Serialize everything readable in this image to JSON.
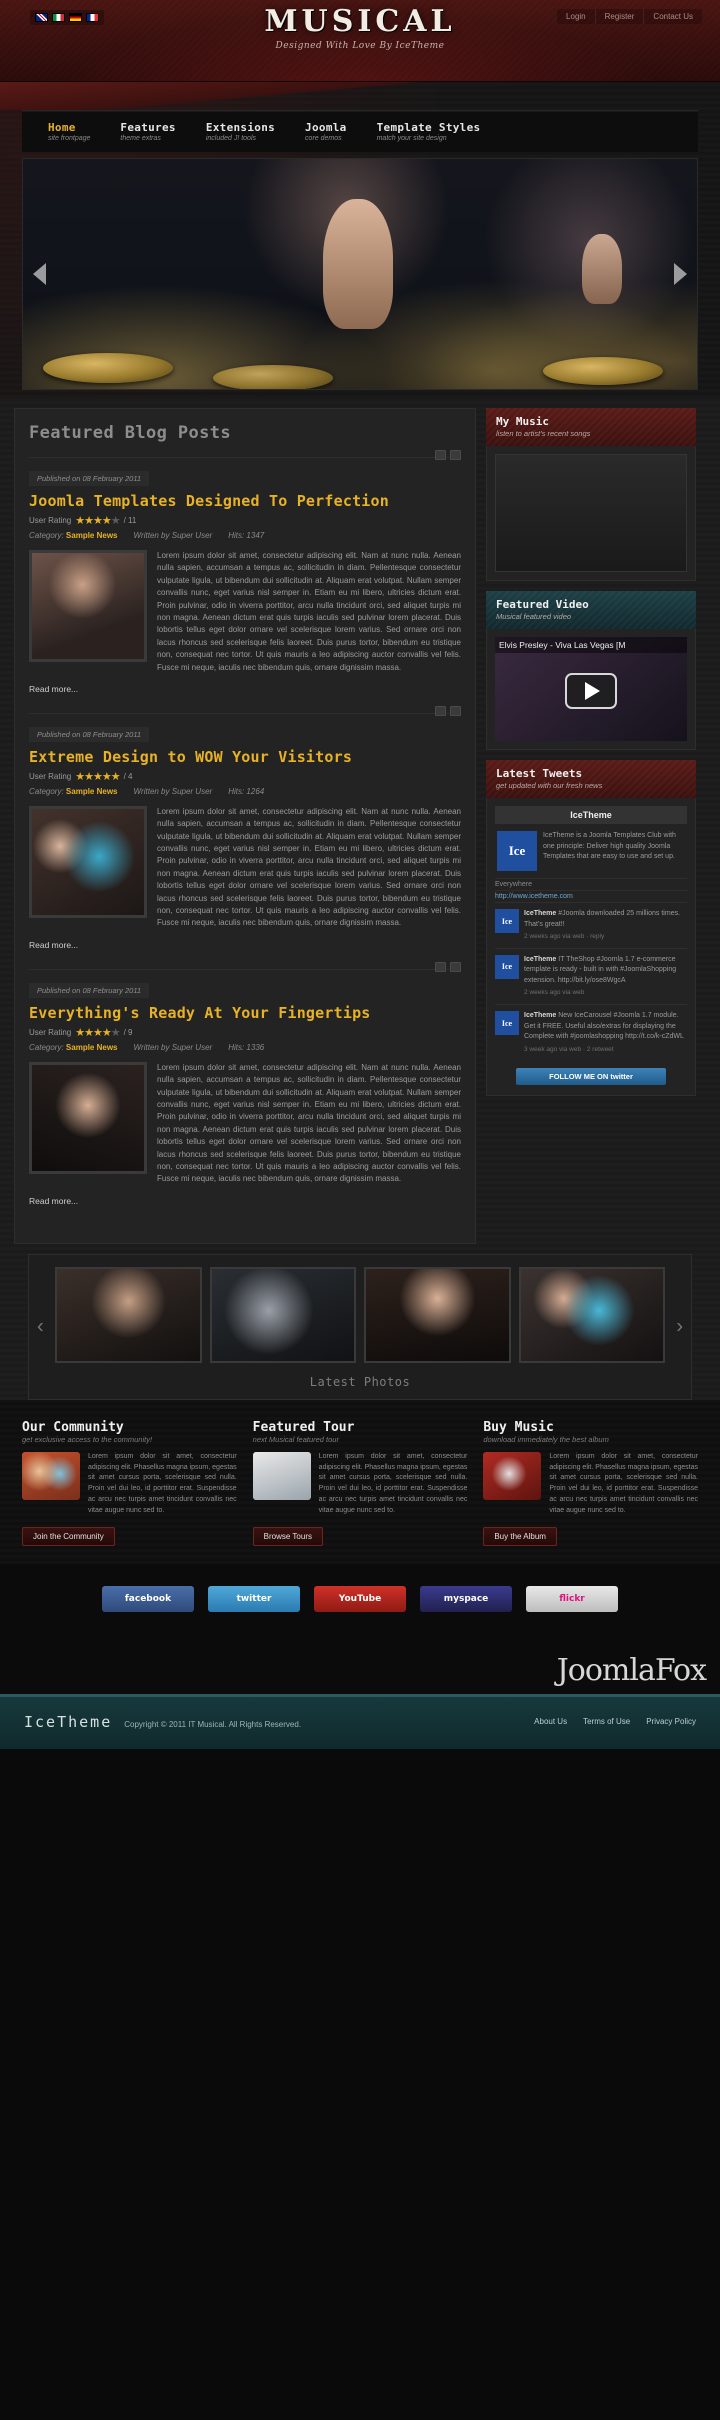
{
  "header": {
    "logo_title": "MUSICAL",
    "logo_sub": "Designed With Love By IceTheme",
    "flags": [
      "uk-flag",
      "italy-flag",
      "germany-flag",
      "france-flag"
    ],
    "top_links": [
      "Login",
      "Register",
      "Contact Us"
    ]
  },
  "nav": [
    {
      "title": "Home",
      "sub": "site frontpage",
      "active": true
    },
    {
      "title": "Features",
      "sub": "theme extras",
      "active": false
    },
    {
      "title": "Extensions",
      "sub": "included J! tools",
      "active": false
    },
    {
      "title": "Joomla",
      "sub": "core demos",
      "active": false
    },
    {
      "title": "Template Styles",
      "sub": "match your site design",
      "active": false
    }
  ],
  "main": {
    "section_title": "Featured Blog Posts",
    "read_more": "Read more...",
    "posts": [
      {
        "published": "Published on 08 February 2011",
        "title": "Joomla Templates Designed To Perfection",
        "rating_label": "User Rating",
        "stars_on": 4,
        "stars_off": 1,
        "votes": "/ 11",
        "category_label": "Category:",
        "category": "Sample News",
        "author": "Written by Super User",
        "hits": "Hits: 1347",
        "text": "Lorem ipsum dolor sit amet, consectetur adipiscing elit. Nam at nunc nulla. Aenean nulla sapien, accumsan a tempus ac, sollicitudin in diam. Pellentesque consectetur vulputate ligula, ut bibendum dui sollicitudin at. Aliquam erat volutpat. Nullam semper convallis nunc, eget varius nisl semper in. Etiam eu mi libero, ultricies dictum erat. Proin pulvinar, odio in viverra porttitor, arcu nulla tincidunt orci, sed aliquet turpis mi non magna. Aenean dictum erat quis turpis iaculis sed pulvinar lorem placerat. Duis lobortis tellus eget dolor ornare vel scelerisque lorem varius. Sed ornare orci non lacus rhoncus sed scelerisque felis laoreet. Duis purus tortor, bibendum eu tristique non, consequat nec tortor. Ut quis mauris a leo adipiscing auctor convallis vel felis. Fusce mi neque, iaculis nec bibendum quis, ornare dignissim massa."
      },
      {
        "published": "Published on 08 February 2011",
        "title": "Extreme Design to WOW Your Visitors",
        "rating_label": "User Rating",
        "stars_on": 5,
        "stars_off": 0,
        "votes": "/ 4",
        "category_label": "Category:",
        "category": "Sample News",
        "author": "Written by Super User",
        "hits": "Hits: 1264",
        "text": "Lorem ipsum dolor sit amet, consectetur adipiscing elit. Nam at nunc nulla. Aenean nulla sapien, accumsan a tempus ac, sollicitudin in diam. Pellentesque consectetur vulputate ligula, ut bibendum dui sollicitudin at. Aliquam erat volutpat. Nullam semper convallis nunc, eget varius nisl semper in. Etiam eu mi libero, ultricies dictum erat. Proin pulvinar, odio in viverra porttitor, arcu nulla tincidunt orci, sed aliquet turpis mi non magna. Aenean dictum erat quis turpis iaculis sed pulvinar lorem placerat. Duis lobortis tellus eget dolor ornare vel scelerisque lorem varius. Sed ornare orci non lacus rhoncus sed scelerisque felis laoreet. Duis purus tortor, bibendum eu tristique non, consequat nec tortor. Ut quis mauris a leo adipiscing auctor convallis vel felis. Fusce mi neque, iaculis nec bibendum quis, ornare dignissim massa."
      },
      {
        "published": "Published on 08 February 2011",
        "title": "Everything's Ready At Your Fingertips",
        "rating_label": "User Rating",
        "stars_on": 4,
        "stars_off": 1,
        "votes": "/ 9",
        "category_label": "Category:",
        "category": "Sample News",
        "author": "Written by Super User",
        "hits": "Hits: 1336",
        "text": "Lorem ipsum dolor sit amet, consectetur adipiscing elit. Nam at nunc nulla. Aenean nulla sapien, accumsan a tempus ac, sollicitudin in diam. Pellentesque consectetur vulputate ligula, ut bibendum dui sollicitudin at. Aliquam erat volutpat. Nullam semper convallis nunc, eget varius nisl semper in. Etiam eu mi libero, ultricies dictum erat. Proin pulvinar, odio in viverra porttitor, arcu nulla tincidunt orci, sed aliquet turpis mi non magna. Aenean dictum erat quis turpis iaculis sed pulvinar lorem placerat. Duis lobortis tellus eget dolor ornare vel scelerisque lorem varius. Sed ornare orci non lacus rhoncus sed scelerisque felis laoreet. Duis purus tortor, bibendum eu tristique non, consequat nec tortor. Ut quis mauris a leo adipiscing auctor convallis vel felis. Fusce mi neque, iaculis nec bibendum quis, ornare dignissim massa."
      }
    ]
  },
  "sidebar": {
    "my_music": {
      "title": "My Music",
      "sub": "listen to artist's recent songs"
    },
    "featured_video": {
      "title": "Featured Video",
      "sub": "Musical featured video",
      "video_title": "Elvis Presley - Viva Las Vegas [M"
    },
    "latest_tweets": {
      "title": "Latest Tweets",
      "sub": "get updated with our fresh news",
      "account_name": "IceTheme",
      "avatar_text": "Ice",
      "bio": "IceTheme is a Joomla Templates Club with one principle: Deliver high quality Joomla Templates that are easy to use and set up.",
      "website_label": "Everywhere",
      "website": "http://www.icetheme.com",
      "follow_button": "FOLLOW ME ON twitter",
      "tweets": [
        {
          "user": "IceTheme",
          "text": "#Joomla downloaded 25 millions times. That's great!!",
          "time": "2 weeks ago via web · reply"
        },
        {
          "user": "IceTheme",
          "text": "IT TheShop #Joomla 1.7 e-commerce template is ready - built in with #JoomlaShopping extension. http://bit.ly/ose8WgcA",
          "time": "2 weeks ago via web"
        },
        {
          "user": "IceTheme",
          "text": "New IceCarousel #Joomla 1.7 module. Get it FREE. Useful also/extras for displaying the Complete with #joomlashopping http://t.co/k-cZdWL",
          "time": "3 week ago via web · 2 retweet"
        }
      ]
    }
  },
  "photos": {
    "label": "Latest Photos",
    "prev_icon": "chevron-left-icon",
    "next_icon": "chevron-right-icon",
    "items": [
      "photo-1",
      "photo-2",
      "photo-3",
      "photo-4"
    ]
  },
  "bottom_modules": [
    {
      "title": "Our Community",
      "sub": "get exclusive access to the community!",
      "text": "Lorem ipsum dolor sit amet, consectetur adipiscing elit. Phasellus magna ipsum, egestas sit amet cursus porta, scelerisque sed nulla. Proin vel dui leo, id porttitor erat. Suspendisse ac arcu nec turpis amet tincidunt convallis nec vitae augue nunc sed to.",
      "button": "Join the Community"
    },
    {
      "title": "Featured Tour",
      "sub": "next Musical featured tour",
      "text": "Lorem ipsum dolor sit amet, consectetur adipiscing elit. Phasellus magna ipsum, egestas sit amet cursus porta, scelerisque sed nulla. Proin vel dui leo, id porttitor erat. Suspendisse ac arcu nec turpis amet tincidunt convallis nec vitae augue nunc sed to.",
      "button": "Browse Tours"
    },
    {
      "title": "Buy Music",
      "sub": "download immediately the best album",
      "text": "Lorem ipsum dolor sit amet, consectetur adipiscing elit. Phasellus magna ipsum, egestas sit amet cursus porta, scelerisque sed nulla. Proin vel dui leo, id porttitor erat. Suspendisse ac arcu nec turpis amet tincidunt convallis nec vitae augue nunc sed to.",
      "button": "Buy the Album"
    }
  ],
  "social": [
    {
      "name": "facebook",
      "label": "facebook"
    },
    {
      "name": "twitter",
      "label": "twitter"
    },
    {
      "name": "youtube",
      "label": "YouTube"
    },
    {
      "name": "myspace",
      "label": "myspace"
    },
    {
      "name": "flickr",
      "label": "flickr"
    }
  ],
  "brandmark": {
    "title": "JoomlaFox",
    "sub": ""
  },
  "footer": {
    "logo": "IceTheme",
    "copyright": "Copyright © 2011 IT Musical. All Rights Reserved.",
    "links": [
      "About Us",
      "Terms of Use",
      "Privacy Policy"
    ]
  },
  "colors": {
    "accent_gold": "#e8b226",
    "header_red": "#4a1512",
    "module_red": "#5b1b17",
    "module_teal": "#1d4046",
    "footer_teal": "#17393c"
  }
}
